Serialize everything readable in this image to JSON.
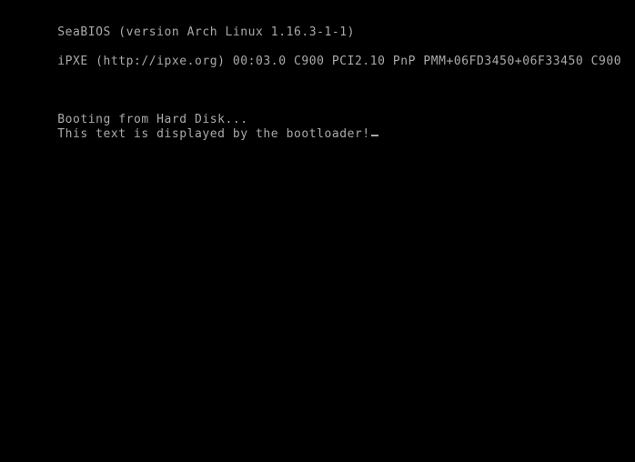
{
  "screen": {
    "type": "bios-boot-console",
    "background_color": "#000000",
    "text_color": "#aaaaaa",
    "columns": 76,
    "rows": 31
  },
  "console": {
    "lines": [
      {
        "id": "bios-version-line",
        "text": "SeaBIOS (version Arch Linux 1.16.3-1-1)",
        "blank": false
      },
      {
        "id": "spacer-1",
        "text": "",
        "blank": true
      },
      {
        "id": "ipxe-line",
        "text": "iPXE (http://ipxe.org) 00:03.0 C900 PCI2.10 PnP PMM+06FD3450+06F33450 C900",
        "blank": false
      },
      {
        "id": "spacer-2",
        "text": "",
        "blank": true
      },
      {
        "id": "spacer-3",
        "text": "",
        "blank": true
      },
      {
        "id": "spacer-4",
        "text": "",
        "blank": true
      },
      {
        "id": "booting-line",
        "text": "Booting from Hard Disk...",
        "blank": false
      },
      {
        "id": "bootloader-message-line",
        "text": "This text is displayed by the bootloader!",
        "blank": false
      }
    ],
    "cursor": {
      "name": "text-cursor",
      "style": "underline",
      "visible": true,
      "after_line": "bootloader-message-line"
    }
  },
  "details": {
    "firmware_name": "SeaBIOS",
    "firmware_version": "Arch Linux 1.16.3-1-1",
    "network_rom": "iPXE",
    "ipxe_url": "http://ipxe.org",
    "pci_address": "00:03.0",
    "device_id_first": "C900",
    "pci_spec": "PCI2.10",
    "pnp": "PnP",
    "pmm_entry": "PMM+06FD3450+06F33450",
    "device_id_last": "C900",
    "boot_source": "Hard Disk",
    "bootloader_message": "This text is displayed by the bootloader!"
  }
}
